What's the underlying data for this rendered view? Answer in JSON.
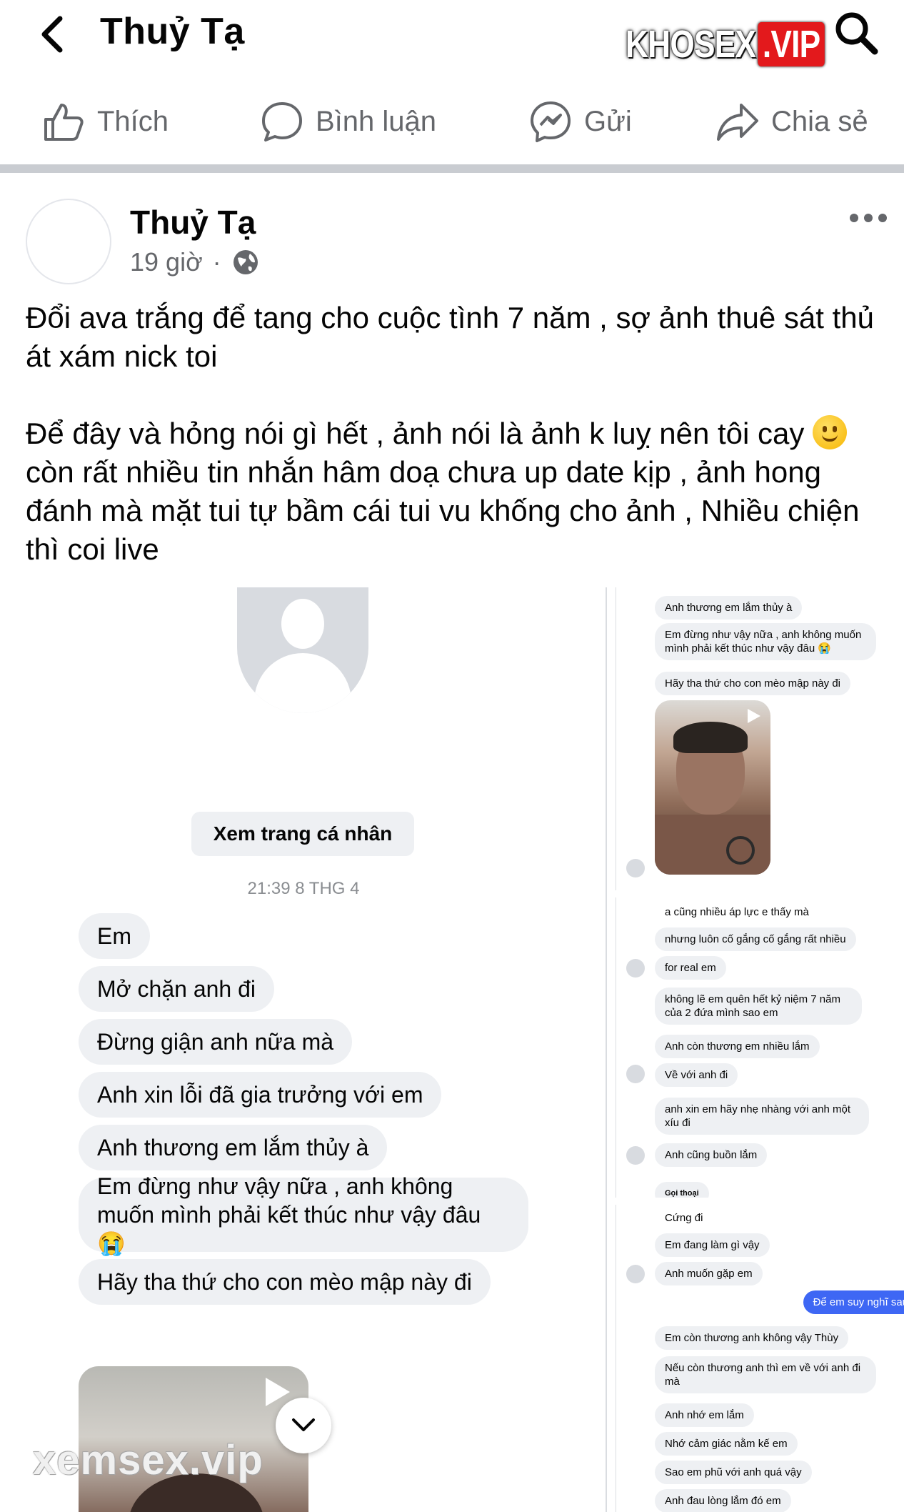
{
  "topbar": {
    "title": "Thuỷ Tạ",
    "watermark_text": "KHOSEX",
    "watermark_badge": ".VIP"
  },
  "actions": [
    {
      "label": "Thích",
      "icon": "like-icon"
    },
    {
      "label": "Bình luận",
      "icon": "comment-icon"
    },
    {
      "label": "Gửi",
      "icon": "messenger-icon"
    },
    {
      "label": "Chia sẻ",
      "icon": "share-icon"
    }
  ],
  "post": {
    "author": "Thuỷ Tạ",
    "time": "19 giờ",
    "separator": "·",
    "privacy_icon": "globe-icon",
    "para1": "Đổi ava trắng để tang cho cuộc tình 7 năm , sợ ảnh thuê sát thủ át xám nick toi",
    "para2_a": "Để đây và hỏng nói gì hết , ảnh nói là ảnh k luỵ nên tôi cay",
    "para2_b": " còn rất nhiều tin nhắn hâm doạ chưa up date kịp  , ảnh hong đánh mà mặt tui tự bầm cái tui vu khống cho ảnh , Nhiều chiện thì coi live"
  },
  "photo_main": {
    "view_profile": "Xem trang cá nhân",
    "timestamp": "21:39 8 THG 4",
    "messages": [
      "Em",
      "Mở chặn anh đi",
      "Đừng giận anh nữa mà",
      "Anh xin lỗi đã gia trưởng với em",
      "Anh thương em lắm thủy à",
      "Em đừng như vậy nữa , anh không muốn mình phải kết thúc như vậy đâu 😭",
      "Hãy tha thứ cho con mèo mập này đi"
    ],
    "watermark": "xemsex.vip"
  },
  "photo_r1": {
    "messages": [
      "Anh thương em lắm thủy à",
      "Em đừng như vậy nữa , anh không muốn mình phải kết thúc như vậy đâu 😭",
      "Hãy tha thứ cho con mèo mập này đi"
    ]
  },
  "photo_r2": {
    "messages": [
      "a cũng nhiều áp lực e thấy mà",
      "nhưng luôn cố gắng cố gắng rất nhiều",
      "for real em",
      "không lẽ em quên hết kỷ niệm 7 năm của 2 đứa mình sao em",
      "Anh còn thương em nhiều lắm",
      "Về với anh đi",
      "anh xin em hãy nhẹ nhàng với anh một xíu đi",
      "Anh cũng buồn lắm",
      "Gọi thoại"
    ]
  },
  "photo_r3": {
    "messages": [
      "Cứng đi",
      "Em đang làm gì vậy",
      "Anh muốn gặp em",
      "Để em suy nghĩ sau",
      "Em còn thương anh không vậy Thùy",
      "Nếu còn thương anh thì em về với anh đi mà",
      "Anh nhớ em lắm",
      "Nhớ cảm giác nằm kế em",
      "Sao em phũ với anh quá vậy",
      "Anh đau lòng lắm đó em"
    ]
  },
  "colors": {
    "text": "#050505",
    "secondary": "#65676b",
    "bubble": "#eef0f3",
    "outgoing": "#3e67f4",
    "divider": "#c9ccd1"
  }
}
